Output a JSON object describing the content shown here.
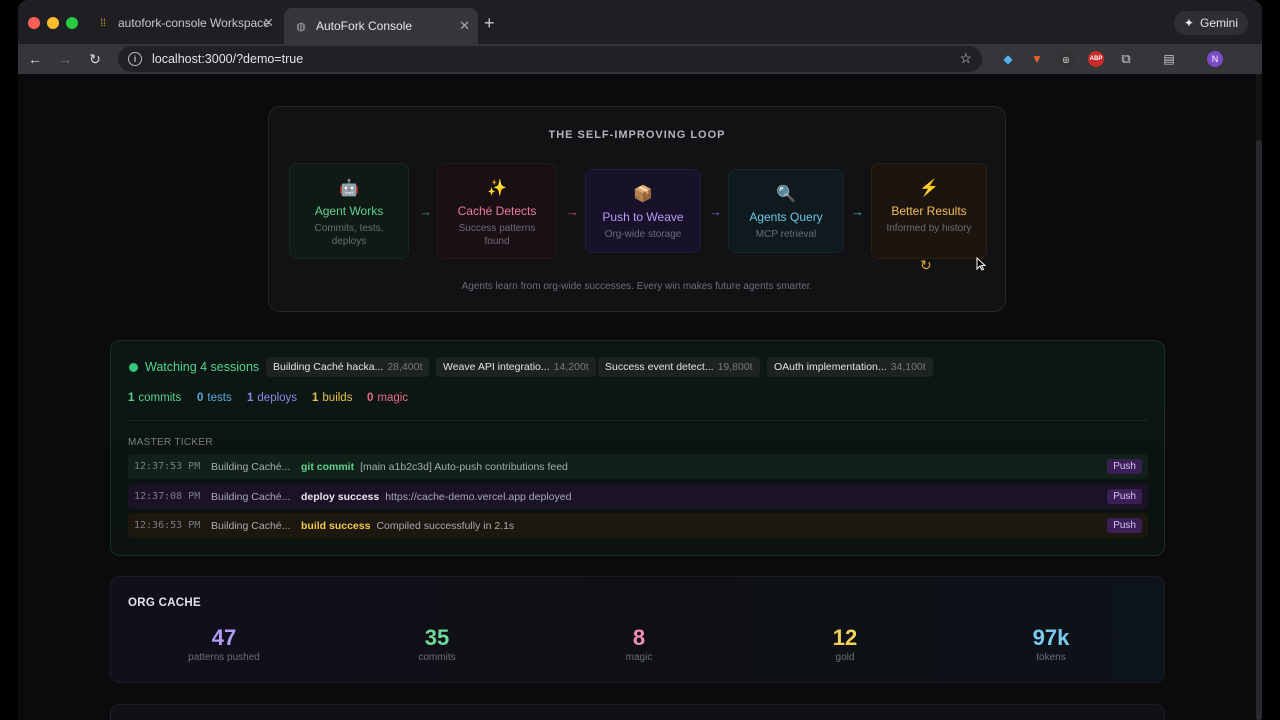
{
  "browser": {
    "tabs": [
      {
        "title": "autofork-console Workspace"
      },
      {
        "title": "AutoFork Console"
      }
    ],
    "gemini_label": "Gemini",
    "url": "localhost:3000/?demo=true",
    "profile_initial": "N"
  },
  "loop": {
    "title": "THE SELF-IMPROVING LOOP",
    "steps": [
      {
        "icon": "robot-icon",
        "emoji": "🤖",
        "name": "Agent Works",
        "desc": "Commits, tests, deploys",
        "color": "#5fd08d"
      },
      {
        "icon": "sparkles-icon",
        "emoji": "✨",
        "name": "Caché Detects",
        "desc": "Success patterns found",
        "color": "#f07c9a"
      },
      {
        "icon": "package-icon",
        "emoji": "📦",
        "name": "Push to Weave",
        "desc": "Org-wide storage",
        "color": "#b69cf5"
      },
      {
        "icon": "magnifier-icon",
        "emoji": "🔍",
        "name": "Agents Query",
        "desc": "MCP retrieval",
        "color": "#6fc6e6"
      },
      {
        "icon": "lightning-icon",
        "emoji": "⚡",
        "name": "Better Results",
        "desc": "Informed by history",
        "color": "#f2c055"
      }
    ],
    "arrow": "→",
    "footer": "Agents learn from org-wide successes. Every win makes future agents smarter."
  },
  "watch": {
    "label": "Watching 4 sessions",
    "sessions": [
      {
        "name": "Building Caché hacka...",
        "tokens": "28,400t"
      },
      {
        "name": "Weave API integratio...",
        "tokens": "14,200t"
      },
      {
        "name": "Success event detect...",
        "tokens": "19,800t"
      },
      {
        "name": "OAuth implementation...",
        "tokens": "34,100t"
      }
    ],
    "stats": [
      {
        "count": "1",
        "label": "commits",
        "color": "#5fd08d"
      },
      {
        "count": "0",
        "label": "tests",
        "color": "#5aa8e0"
      },
      {
        "count": "1",
        "label": "deploys",
        "color": "#8f86e8"
      },
      {
        "count": "1",
        "label": "builds",
        "color": "#e9c04f"
      },
      {
        "count": "0",
        "label": "magic",
        "color": "#e86a8a"
      }
    ],
    "ticker_title": "MASTER TICKER",
    "ticker": [
      {
        "time": "12:37:53 PM",
        "session": "Building Caché...",
        "event": "git commit",
        "message": "[main a1b2c3d] Auto-push contributions feed",
        "badge": "Push"
      },
      {
        "time": "12:37:08 PM",
        "session": "Building Caché...",
        "event": "deploy success",
        "message": "https://cache-demo.vercel.app deployed",
        "badge": "Push"
      },
      {
        "time": "12:36:53 PM",
        "session": "Building Caché...",
        "event": "build success",
        "message": "Compiled successfully in 2.1s",
        "badge": "Push"
      }
    ]
  },
  "cache": {
    "title": "ORG CACHE",
    "stats": [
      {
        "value": "47",
        "label": "patterns pushed",
        "color": "#b29cf6"
      },
      {
        "value": "35",
        "label": "commits",
        "color": "#6fd99a"
      },
      {
        "value": "8",
        "label": "magic",
        "color": "#f28fb6"
      },
      {
        "value": "12",
        "label": "gold",
        "color": "#f2d25a"
      },
      {
        "value": "97k",
        "label": "tokens",
        "color": "#7cc9f0"
      }
    ]
  }
}
